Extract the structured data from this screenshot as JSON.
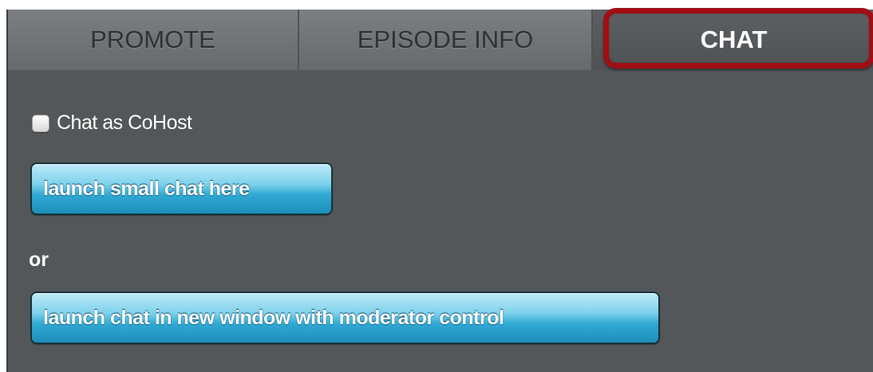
{
  "tabs": [
    {
      "label": "PROMOTE",
      "active": false
    },
    {
      "label": "EPISODE INFO",
      "active": false
    },
    {
      "label": "CHAT",
      "active": true,
      "highlighted": true
    }
  ],
  "chat_panel": {
    "cohost_checkbox": {
      "label": "Chat as CoHost",
      "checked": false
    },
    "launch_small_label": "launch small chat here",
    "or_label": "or",
    "launch_window_label": "launch chat in new window with moderator control"
  },
  "colors": {
    "panel_background": "#545759",
    "highlight_ring": "#a10e14",
    "button_gradient_top": "#bdebf8",
    "button_gradient_bottom": "#1d8fb9"
  }
}
